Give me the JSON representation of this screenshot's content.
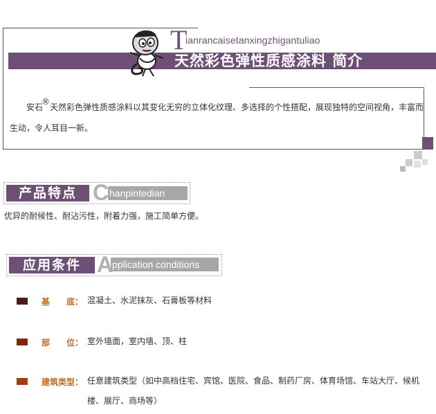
{
  "intro": {
    "pinyin_initial": "T",
    "pinyin_rest": "ianrancaisetanxingzhigantuliao",
    "title": "天然彩色弹性质感涂料 简介",
    "brand": "安石",
    "reg_mark": "®",
    "body": "天然彩色弹性质感涂料以其变化无穷的立体化纹理、多选择的个性搭配，展现独特的空间视角，丰富而生动，令人耳目一新。"
  },
  "features": {
    "heading": "产品特点",
    "pinyin_initial": "C",
    "pinyin_rest": "hanpintedian",
    "text": "优异的耐候性、耐沾污性，附着力强，施工简单方便。"
  },
  "conditions": {
    "heading": "应用条件",
    "en_initial": "A",
    "en_rest": "pplication conditions",
    "items": [
      {
        "label": "基　　底：",
        "value": "混凝土、水泥抹灰、石膏板等材料",
        "color": "#4a1f12"
      },
      {
        "label": "部　　位：",
        "value": "室外墙面，室内墙、顶、柱",
        "color": "#7a2a10"
      },
      {
        "label": "建筑类型：",
        "value": "任意建筑类型（如中高档住宅、宾馆、医院、食品、制药厂房、体育场馆、车站大厅、候机楼、展厅、商场等）",
        "color": "#a23e12"
      }
    ]
  },
  "colors": {
    "accent": "#6e4f75",
    "label": "#c06b25",
    "gray": "#a7a7a7"
  }
}
